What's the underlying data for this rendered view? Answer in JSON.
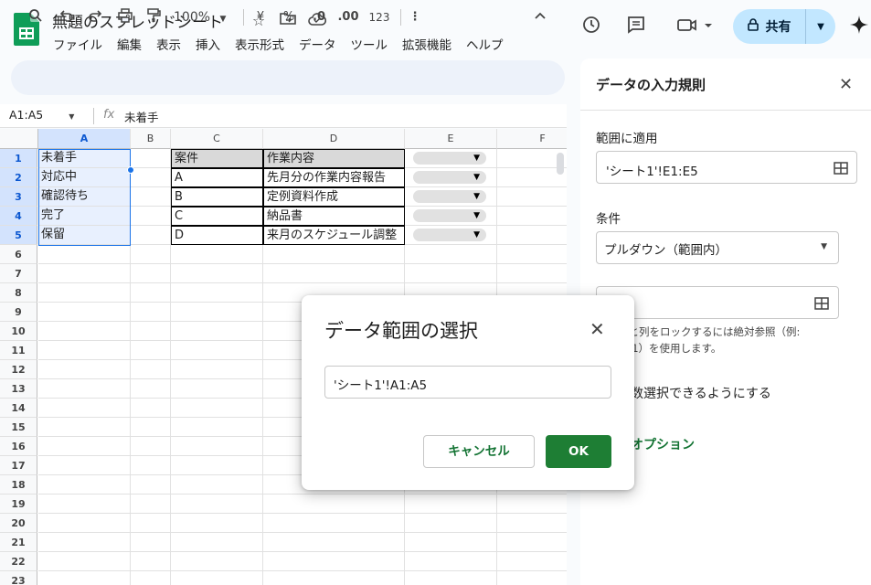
{
  "app": {
    "title": "無題のスプレッドシート",
    "menu": [
      "ファイル",
      "編集",
      "表示",
      "挿入",
      "表示形式",
      "データ",
      "ツール",
      "拡張機能",
      "ヘルプ"
    ],
    "share_label": "共有"
  },
  "toolbar": {
    "zoom": "100%",
    "currency": "¥",
    "percent": "%",
    "dec_decrease": ".0",
    "dec_increase": ".00",
    "format_123": "123"
  },
  "formula_bar": {
    "name_box": "A1:A5",
    "fx": "fx",
    "value": "未着手"
  },
  "sheet": {
    "columns": [
      "A",
      "B",
      "C",
      "D",
      "E",
      "F"
    ],
    "rows": [
      "1",
      "2",
      "3",
      "4",
      "5",
      "6",
      "7",
      "8",
      "9",
      "10",
      "11",
      "12",
      "13",
      "14",
      "15",
      "16",
      "17",
      "18",
      "19",
      "20",
      "21",
      "22",
      "23"
    ],
    "col_a": [
      "未着手",
      "対応中",
      "確認待ち",
      "完了",
      "保留"
    ],
    "table_headers": [
      "案件",
      "作業内容"
    ],
    "table_c": [
      "A",
      "B",
      "C",
      "D"
    ],
    "table_d": [
      "先月分の作業内容報告",
      "定例資料作成",
      "納品書",
      "来月のスケジュール調整"
    ]
  },
  "side_panel": {
    "title": "データの入力規則",
    "range_label": "範囲に適用",
    "range_value": "'シート1'!E1:E5",
    "criteria_label": "条件",
    "criteria_value": "プルダウン（範囲内）",
    "hint_line1": "行と列をロックするには絶対参照（例:",
    "hint_line2": "B$1）を使用します。",
    "multi_select": "複数選択できるようにする",
    "advanced": "細オプション"
  },
  "dialog": {
    "title": "データ範囲の選択",
    "input_value": "'シート1'!A1:A5",
    "cancel_label": "キャンセル",
    "ok_label": "OK"
  },
  "colors": {
    "accent_green": "#137333",
    "ok_bg": "#1e7e34",
    "share_bg": "#c2e7ff",
    "selection_bg": "#e8f0fe"
  }
}
